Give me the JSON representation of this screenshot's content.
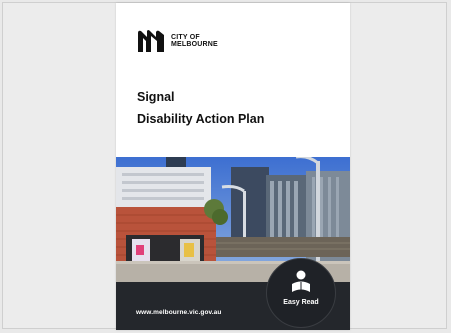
{
  "brand": {
    "name_line1": "CITY OF",
    "name_line2": "MELBOURNE"
  },
  "document": {
    "title_line1": "Signal",
    "title_line2": "Disability Action Plan",
    "badge_label": "Easy Read",
    "website": "www.melbourne.vic.gov.au"
  },
  "photo": {
    "icon": "building-photo"
  },
  "colors": {
    "footer": "#24272c",
    "sky": "#4a78c9"
  }
}
